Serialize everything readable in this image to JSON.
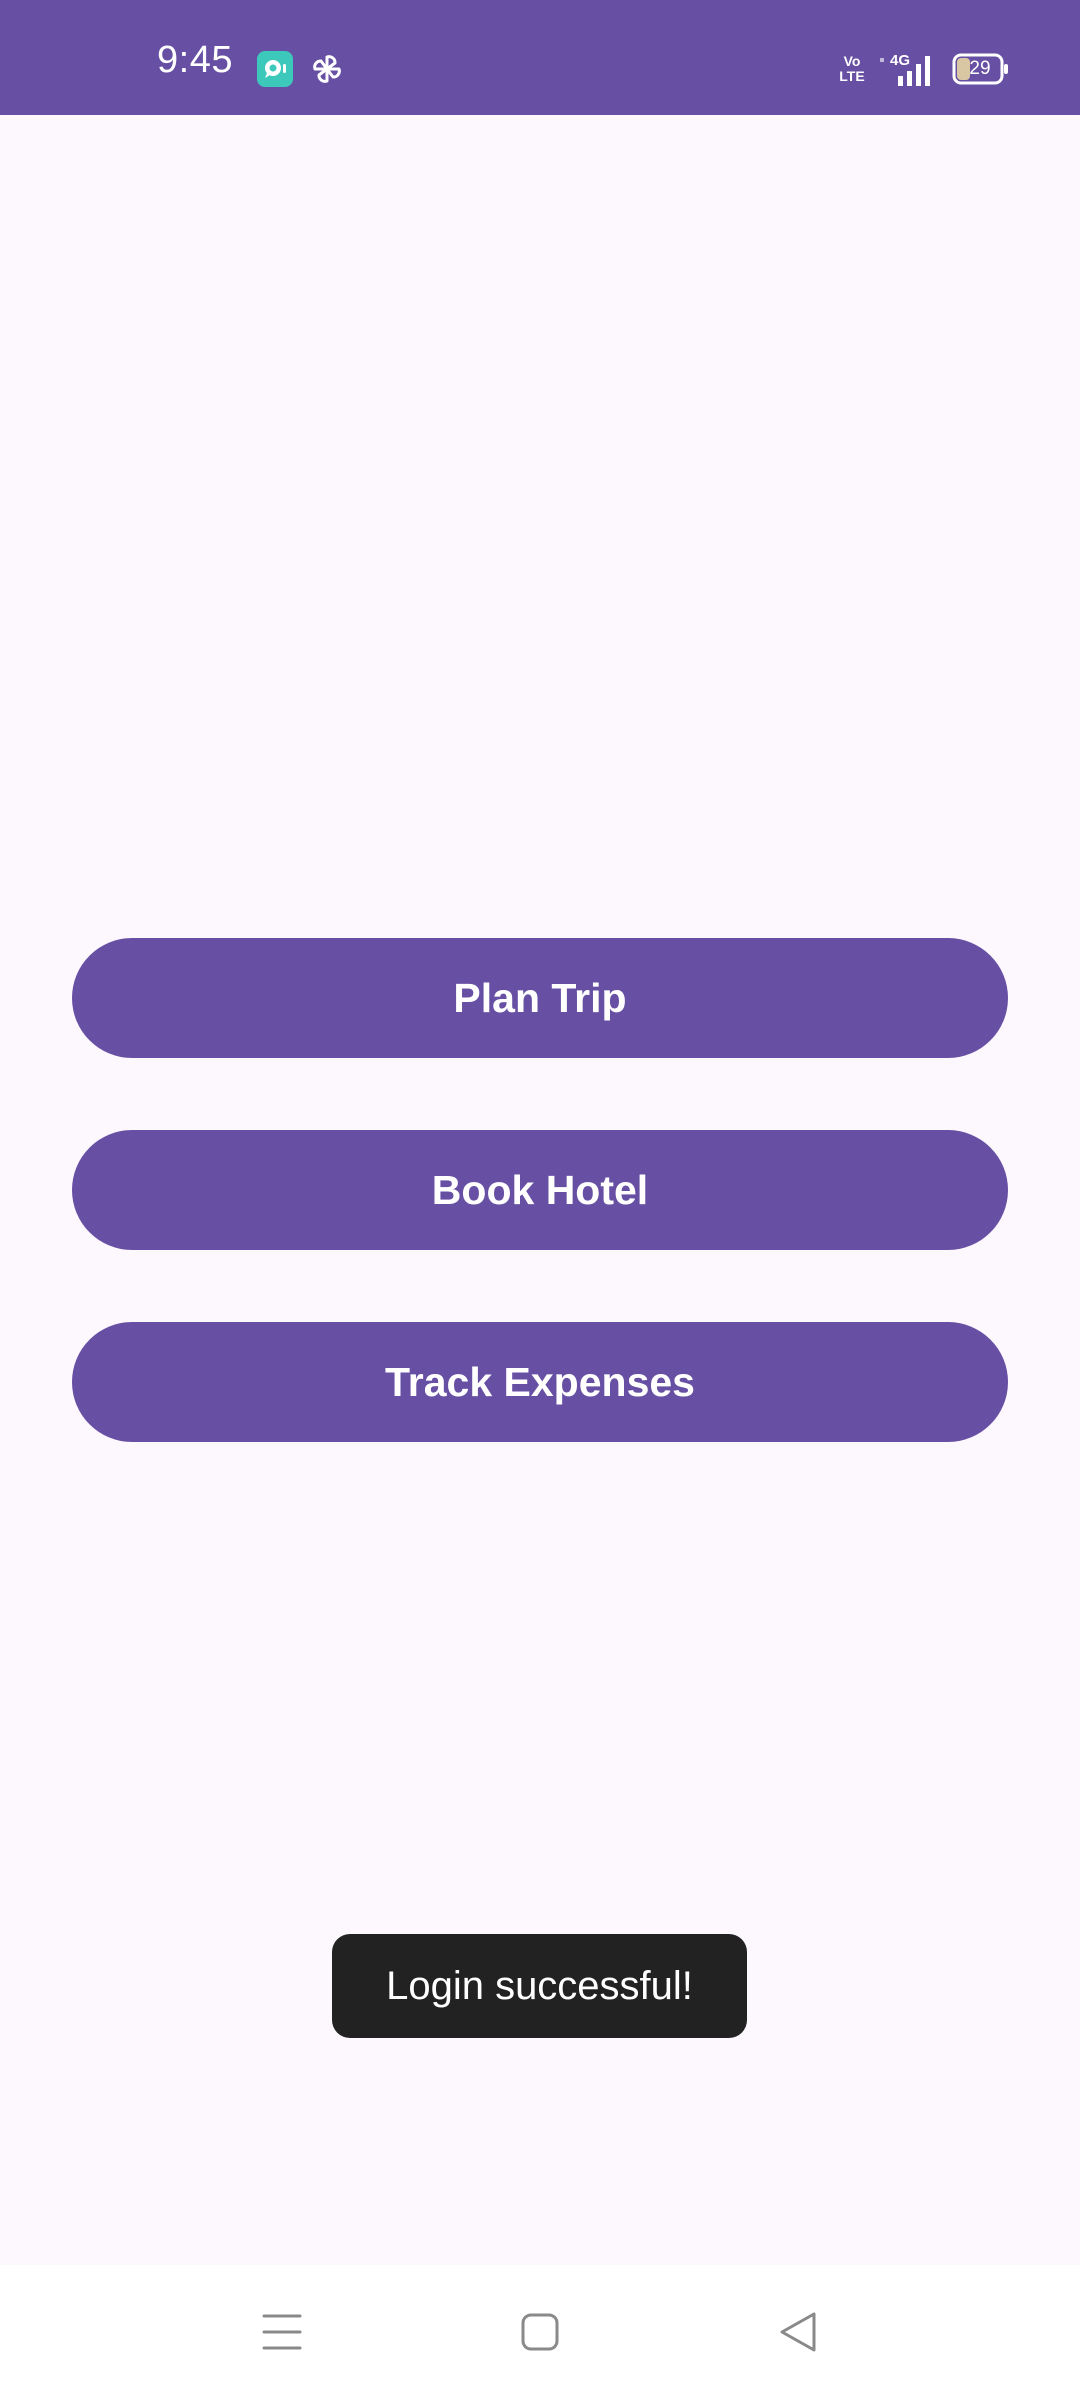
{
  "status_bar": {
    "time": "9:45",
    "network_label": "4G",
    "volte_label": "Vo\nLTE",
    "battery_level": "29",
    "icons": [
      "notification-app-icon",
      "pinwheel-icon",
      "volte-icon",
      "signal-4g-icon",
      "battery-icon"
    ],
    "background_color": "#6750A4"
  },
  "main": {
    "buttons": [
      {
        "label": "Plan Trip"
      },
      {
        "label": "Book Hotel"
      },
      {
        "label": "Track Expenses"
      }
    ],
    "button_color": "#6750A4",
    "background_color": "#FDF7FE"
  },
  "toast": {
    "message": "Login successful!"
  },
  "nav_bar": {
    "icons": [
      "menu-icon",
      "home-icon",
      "back-icon"
    ]
  }
}
